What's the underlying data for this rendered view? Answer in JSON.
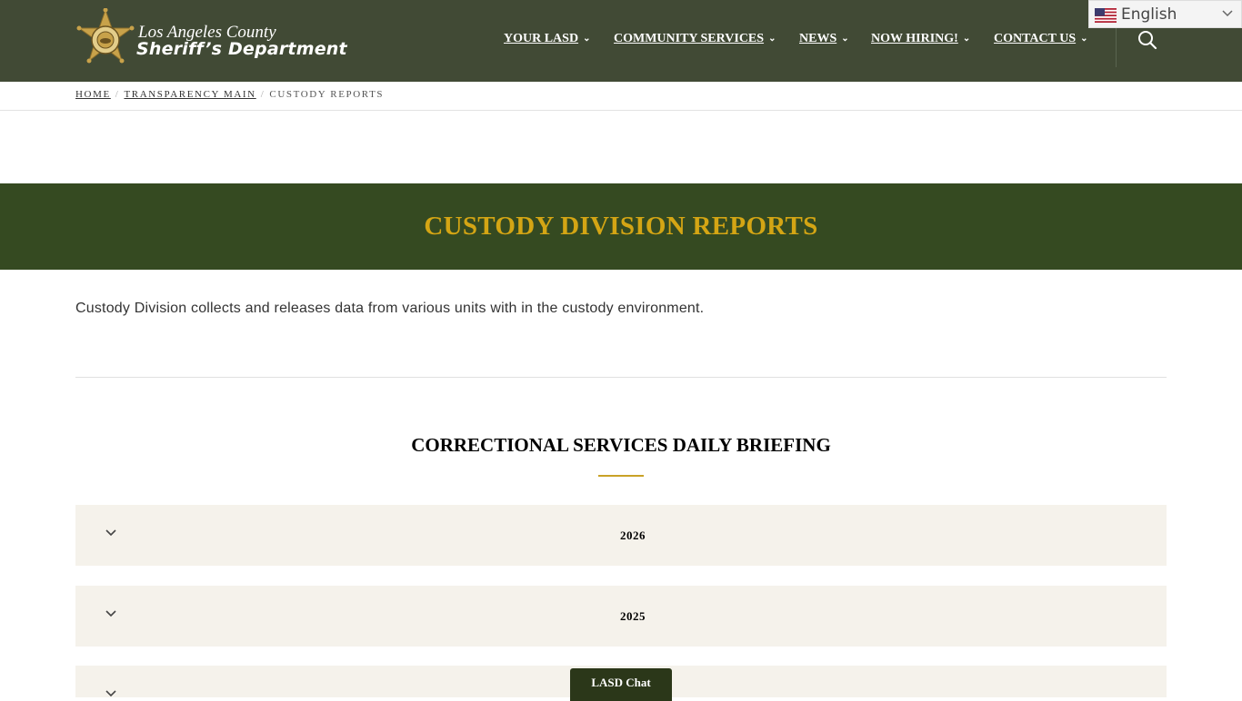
{
  "header": {
    "logo": {
      "line1": "Los Angeles County",
      "line2": "Sheriff’s Department",
      "badge_icon": "sheriff-star-badge"
    },
    "nav": [
      {
        "label": "YOUR LASD"
      },
      {
        "label": "COMMUNITY SERVICES"
      },
      {
        "label": "NEWS"
      },
      {
        "label": "NOW HIRING!"
      },
      {
        "label": "CONTACT US"
      }
    ],
    "nav_chevron": "⌄",
    "search_icon": "search-icon",
    "language": {
      "selected": "English",
      "flag_icon": "us-flag-icon"
    }
  },
  "breadcrumb": {
    "items": [
      "HOME",
      "TRANSPARENCY MAIN"
    ],
    "current": "CUSTODY REPORTS",
    "separator": "/"
  },
  "banner": {
    "title": "CUSTODY DIVISION REPORTS"
  },
  "intro": "Custody Division collects and releases data from various units with in the custody environment.",
  "section": {
    "title": "CORRECTIONAL SERVICES DAILY BRIEFING",
    "accordions": [
      {
        "label": "2026"
      },
      {
        "label": "2025"
      },
      {
        "label": ""
      }
    ]
  },
  "chat": {
    "label": "LASD Chat"
  },
  "colors": {
    "header_bg": "#414a35",
    "banner_bg": "#354a21",
    "banner_title": "#d4a514",
    "accordion_bg": "#f5f2eb",
    "accent": "#c9a227",
    "chat_bg": "#2b3719"
  }
}
